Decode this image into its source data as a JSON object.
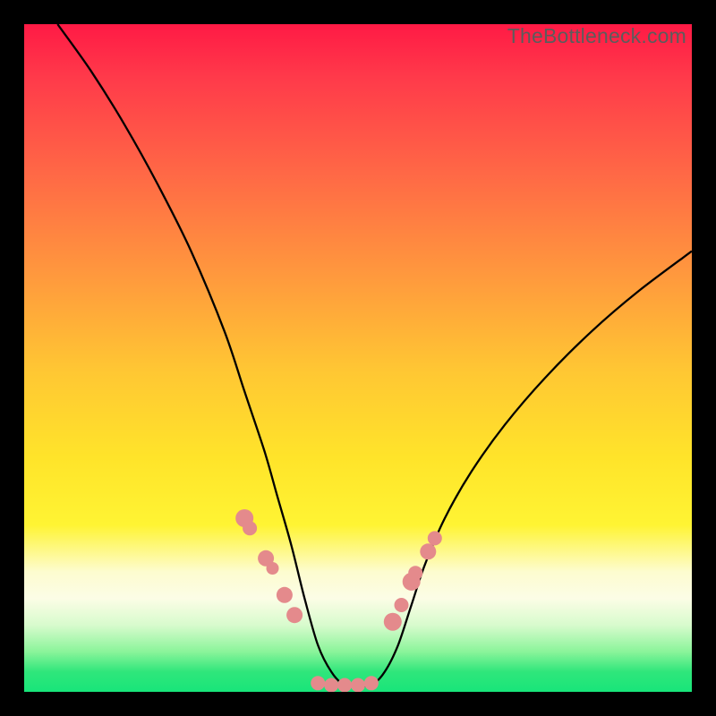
{
  "watermark": "TheBottleneck.com",
  "chart_data": {
    "type": "line",
    "title": "",
    "xlabel": "",
    "ylabel": "",
    "xlim": [
      0,
      100
    ],
    "ylim": [
      0,
      100
    ],
    "grid": false,
    "legend": false,
    "description": "Bottleneck V-curve on red-to-green vertical gradient. Single black curve descending steeply from upper-left, flattening at the bottom (green zone) near x≈44–52, then rising toward upper-right. Salmon-colored data points cluster along the curve near the trough on both sides.",
    "series": [
      {
        "name": "bottleneck-curve",
        "x": [
          5,
          10,
          15,
          20,
          25,
          30,
          33,
          36,
          38,
          40,
          42,
          44,
          46,
          48,
          50,
          52,
          54,
          56,
          58,
          60,
          63,
          67,
          72,
          78,
          85,
          92,
          100
        ],
        "y": [
          100,
          93,
          85,
          76,
          66,
          54,
          45,
          36,
          29,
          22,
          14,
          7,
          3,
          1,
          1,
          1,
          3,
          7,
          13,
          19,
          26,
          33,
          40,
          47,
          54,
          60,
          66
        ]
      }
    ],
    "points": {
      "name": "sample-dots",
      "color": "#e48a8c",
      "x": [
        33.0,
        33.8,
        36.2,
        37.2,
        39.0,
        40.5,
        44.0,
        46.0,
        48.0,
        50.0,
        52.0,
        55.2,
        56.5,
        58.0,
        58.6,
        60.5,
        61.5
      ],
      "y": [
        26.0,
        24.5,
        20.0,
        18.5,
        14.5,
        11.5,
        1.3,
        1.0,
        1.0,
        1.0,
        1.3,
        10.5,
        13.0,
        16.5,
        17.8,
        21.0,
        23.0
      ],
      "r": [
        10,
        8,
        9,
        7,
        9,
        9,
        8,
        8,
        8,
        8,
        8,
        10,
        8,
        10,
        8,
        9,
        8
      ]
    },
    "gradient_stops": [
      {
        "pos": 0.0,
        "color": "#ff1a45"
      },
      {
        "pos": 0.38,
        "color": "#ff9a3d"
      },
      {
        "pos": 0.65,
        "color": "#ffe42a"
      },
      {
        "pos": 0.86,
        "color": "#fcfde6"
      },
      {
        "pos": 1.0,
        "color": "#18e57a"
      }
    ]
  }
}
